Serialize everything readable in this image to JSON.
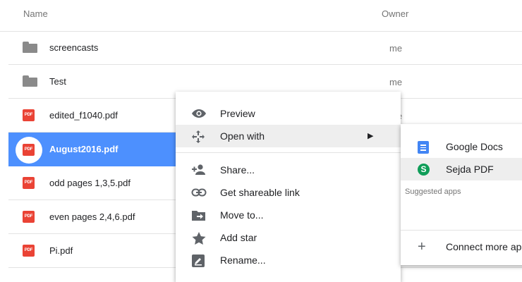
{
  "header": {
    "name_label": "Name",
    "owner_label": "Owner"
  },
  "files": [
    {
      "name": "screencasts",
      "owner": "me",
      "type": "folder"
    },
    {
      "name": "Test",
      "owner": "me",
      "type": "folder"
    },
    {
      "name": "edited_f1040.pdf",
      "owner": "me",
      "type": "pdf"
    },
    {
      "name": "August2016.pdf",
      "owner": "",
      "type": "pdf",
      "selected": true
    },
    {
      "name": "odd pages 1,3,5.pdf",
      "owner": "",
      "type": "pdf"
    },
    {
      "name": "even pages 2,4,6.pdf",
      "owner": "",
      "type": "pdf"
    },
    {
      "name": "Pi.pdf",
      "owner": "",
      "type": "pdf"
    }
  ],
  "pdf_badge": "PDF",
  "context_menu": {
    "preview": "Preview",
    "open_with": "Open with",
    "share": "Share...",
    "get_link": "Get shareable link",
    "move_to": "Move to...",
    "add_star": "Add star",
    "rename": "Rename..."
  },
  "submenu": {
    "google_docs": "Google Docs",
    "sejda_pdf": "Sejda PDF",
    "sejda_glyph": "S",
    "suggested": "Suggested apps",
    "connect_more": "Connect more apps"
  },
  "colors": {
    "selection": "#4d90fe",
    "pdf_red": "#ea4335",
    "docs_blue": "#4285f4",
    "sejda_green": "#0f9d58"
  }
}
